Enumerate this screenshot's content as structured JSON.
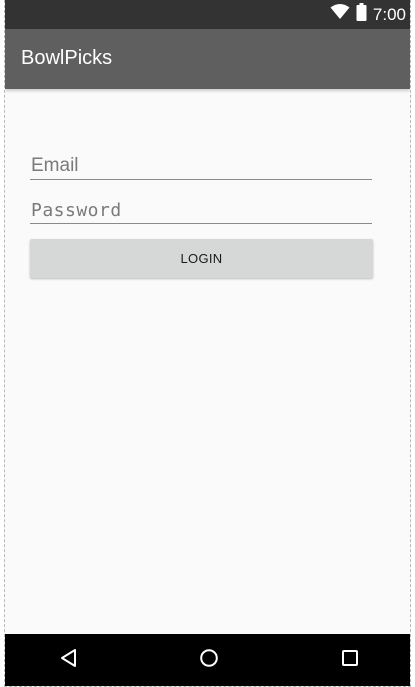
{
  "status_bar": {
    "time": "7:00",
    "icons": [
      "wifi-icon",
      "battery-icon"
    ]
  },
  "app_bar": {
    "title": "BowlPicks"
  },
  "login_form": {
    "email_placeholder": "Email",
    "email_value": "",
    "password_placeholder": "Password",
    "password_value": "",
    "login_label": "LOGIN"
  },
  "nav_bar": {
    "buttons": [
      "back-icon",
      "home-icon",
      "recents-icon"
    ]
  },
  "colors": {
    "status_bar": "#333333",
    "app_bar": "#5f5f5f",
    "background": "#fafafa",
    "button": "#d6d7d7",
    "nav_bar": "#000000"
  }
}
